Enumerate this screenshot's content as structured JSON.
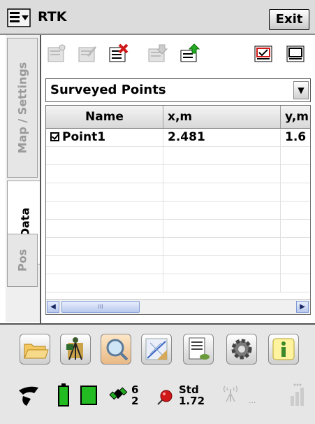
{
  "title_bar": {
    "title": "RTK",
    "exit_label": "Exit",
    "menu_icon": "start-menu-icon"
  },
  "tabs": [
    {
      "label": "Map / Settings",
      "active": false
    },
    {
      "label": "Data",
      "active": true
    },
    {
      "label": "Pos",
      "active": false
    }
  ],
  "toolbar": {
    "icons": [
      "new-point-icon",
      "edit-point-icon",
      "delete-point-icon",
      "import-icon",
      "export-icon",
      "select-all-icon",
      "deselect-icon"
    ]
  },
  "dropdown": {
    "selected": "Surveyed Points"
  },
  "table": {
    "columns": [
      "Name",
      "x,m",
      "y,m"
    ],
    "rows": [
      {
        "checked": true,
        "name": "Point1",
        "x": "2.481",
        "y": "1.6"
      }
    ]
  },
  "scrollbar": {
    "thumb_label": "III"
  },
  "bottom_toolbar": {
    "icons": [
      "open-folder-icon",
      "survey-tripod-icon",
      "search-magnifier-icon",
      "cogo-icon",
      "notes-icon",
      "settings-gear-icon",
      "info-icon"
    ]
  },
  "status": {
    "sats_top": "6",
    "sats_bottom": "2",
    "mode_label": "Std",
    "mode_value": "1.72",
    "ellipsis": "..."
  },
  "colors": {
    "accent_red": "#d01818",
    "accent_green": "#22aa22",
    "tab_gray": "#9a9a9a"
  }
}
